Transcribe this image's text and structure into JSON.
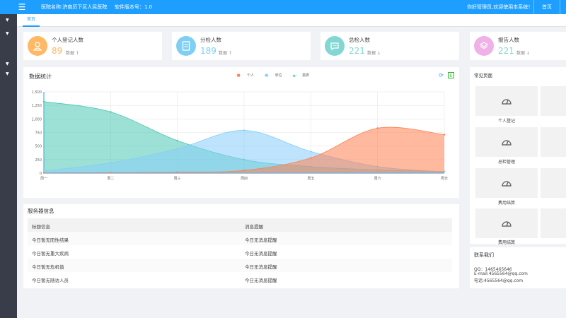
{
  "header": {
    "hospital_name": "医院名称:济南历下区人民医院",
    "version": "软件版本号：1.0",
    "welcome": "你好管理员,欢迎使用本系统！",
    "home_label": "首页"
  },
  "tabs": [
    {
      "label": "首页"
    }
  ],
  "stats": [
    {
      "title": "个人登记人数",
      "value": "89",
      "sub": "数据 ↑",
      "color": "#ffb865"
    },
    {
      "title": "分检人数",
      "value": "189",
      "sub": "数据 ↑",
      "color": "#7fcff4"
    },
    {
      "title": "总检人数",
      "value": "221",
      "sub": "数据 ↓",
      "color": "#82d6d3"
    },
    {
      "title": "报告人数",
      "value": "221",
      "sub": "数据 ↓",
      "color": "#f0b1e6"
    }
  ],
  "chart_title": "数据统计",
  "chart_data": {
    "type": "area",
    "categories": [
      "周一",
      "周二",
      "周三",
      "周四",
      "周五",
      "周六",
      "周日"
    ],
    "y_ticks": [
      "0",
      "250",
      "500",
      "750",
      "1,000",
      "1,250",
      "1,500"
    ],
    "ylim": [
      0,
      1500
    ],
    "grid": true,
    "legend": "top-center",
    "series": [
      {
        "name": "个人",
        "values": [
          5,
          10,
          20,
          50,
          280,
          830,
          710
        ],
        "color": "#ff7f50"
      },
      {
        "name": "单位",
        "values": [
          40,
          190,
          450,
          790,
          400,
          120,
          25
        ],
        "color": "#87cefa"
      },
      {
        "name": "报表",
        "values": [
          1320,
          1130,
          600,
          250,
          120,
          60,
          30
        ],
        "color": "#4cc6b3"
      }
    ]
  },
  "icons": {
    "refresh": "⟳",
    "excel": "E"
  },
  "server": {
    "title": "服务器信息",
    "columns": [
      "标题信息",
      "消息提醒"
    ],
    "rows": [
      [
        "今日暂无阳性结果",
        "今日无消息提醒"
      ],
      [
        "今日暂无重大疾病",
        "今日无消息提醒"
      ],
      [
        "今日暂无危机值",
        "今日无消息提醒"
      ],
      [
        "今日暂无随访人员",
        "今日无消息提醒"
      ]
    ]
  },
  "common_pages": {
    "title": "常见页面",
    "items": [
      "个人登记",
      "总检管理",
      "费用结算",
      "费用结算"
    ]
  },
  "contact": {
    "title": "联系我们",
    "qq": "QQ：1465465646",
    "email": "E-mail:4565564@qq.com",
    "phone": "电话:4565564@qq.com"
  }
}
